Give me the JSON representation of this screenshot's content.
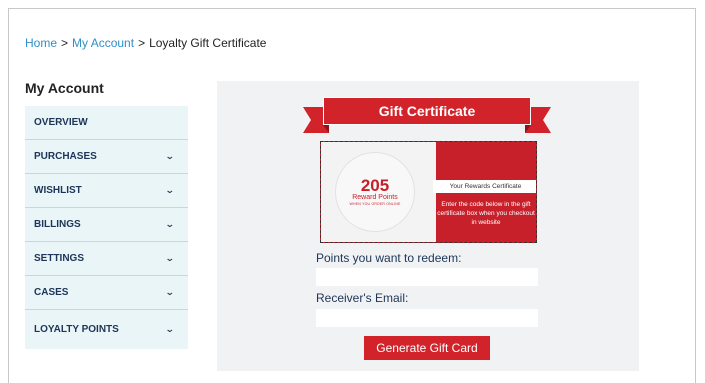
{
  "breadcrumb": {
    "home": "Home",
    "sep": ">",
    "account": "My Account",
    "current": "Loyalty Gift Certificate"
  },
  "sidebar": {
    "title": "My Account",
    "chevron_icon": "chevron-down-icon",
    "items": [
      {
        "label": "OVERVIEW",
        "has_chevron": false
      },
      {
        "label": "PURCHASES",
        "has_chevron": true
      },
      {
        "label": "WISHLIST",
        "has_chevron": true
      },
      {
        "label": "BILLINGS",
        "has_chevron": true
      },
      {
        "label": "SETTINGS",
        "has_chevron": true
      },
      {
        "label": "CASES",
        "has_chevron": true
      },
      {
        "label": "LOYALTY POINTS",
        "has_chevron": true
      }
    ]
  },
  "gift": {
    "title": "Gift Certificate",
    "points": "205",
    "points_label": "Reward Points",
    "points_subtext": "WHEN YOU ORDER ONLINE",
    "band_text": "Your Rewards Certificate",
    "instructions": "Enter the code below in the gift certificate box when you checkout in website"
  },
  "form": {
    "points_label": "Points you want to redeem:",
    "points_value": "",
    "email_label": "Receiver's Email:",
    "email_value": "",
    "button_label": "Generate Gift Card"
  },
  "colors": {
    "accent": "#d2232a",
    "link": "#2f8fc9",
    "sidebar_bg": "#eaf5f8",
    "panel_bg": "#f0f2f4",
    "nav_text": "#1d3557"
  }
}
